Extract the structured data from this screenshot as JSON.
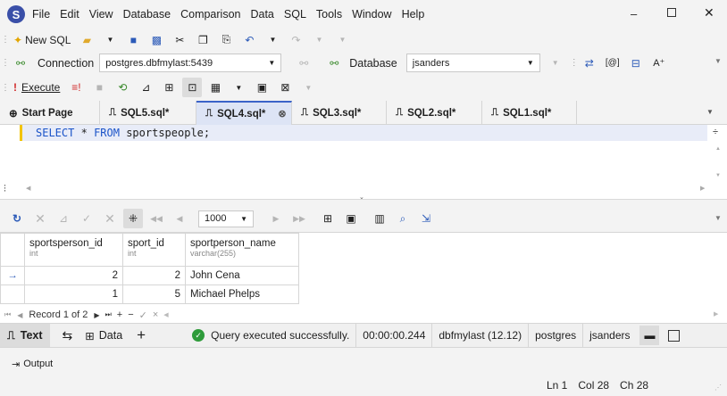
{
  "menu": {
    "items": [
      "File",
      "Edit",
      "View",
      "Database",
      "Comparison",
      "Data",
      "SQL",
      "Tools",
      "Window",
      "Help"
    ]
  },
  "toolbar1": {
    "new_sql": "New SQL"
  },
  "toolbar2": {
    "connection_label": "Connection",
    "connection_value": "postgres.dbfmylast:5439",
    "database_label": "Database",
    "database_value": "jsanders"
  },
  "toolbar3": {
    "execute": "Execute"
  },
  "tabs": [
    "Start Page",
    "SQL5.sql*",
    "SQL4.sql*",
    "SQL3.sql*",
    "SQL2.sql*",
    "SQL1.sql*"
  ],
  "editor": {
    "kw1": "SELECT",
    "star": "*",
    "kw2": "FROM",
    "table": "sportspeople",
    "semi": ";"
  },
  "results_toolbar": {
    "page_size": "1000"
  },
  "grid": {
    "columns": [
      {
        "name": "sportsperson_id",
        "type": "int"
      },
      {
        "name": "sport_id",
        "type": "int"
      },
      {
        "name": "sportperson_name",
        "type": "varchar(255)"
      }
    ],
    "rows": [
      [
        "2",
        "2",
        "John Cena"
      ],
      [
        "1",
        "5",
        "Michael Phelps"
      ]
    ]
  },
  "navigator": {
    "record": "Record 1 of 2"
  },
  "status_bar": {
    "text_tab": "Text",
    "data_tab": "Data",
    "message": "Query executed successfully.",
    "elapsed": "00:00:00.244",
    "server": "dbfmylast (12.12)",
    "database": "postgres",
    "user": "jsanders"
  },
  "output": {
    "label": "Output"
  },
  "position": {
    "ln": "Ln 1",
    "col": "Col 28",
    "ch": "Ch 28"
  },
  "colors": {
    "accent": "#3b63c9",
    "success": "#2e9b3a",
    "keyword": "#1a53c8"
  }
}
